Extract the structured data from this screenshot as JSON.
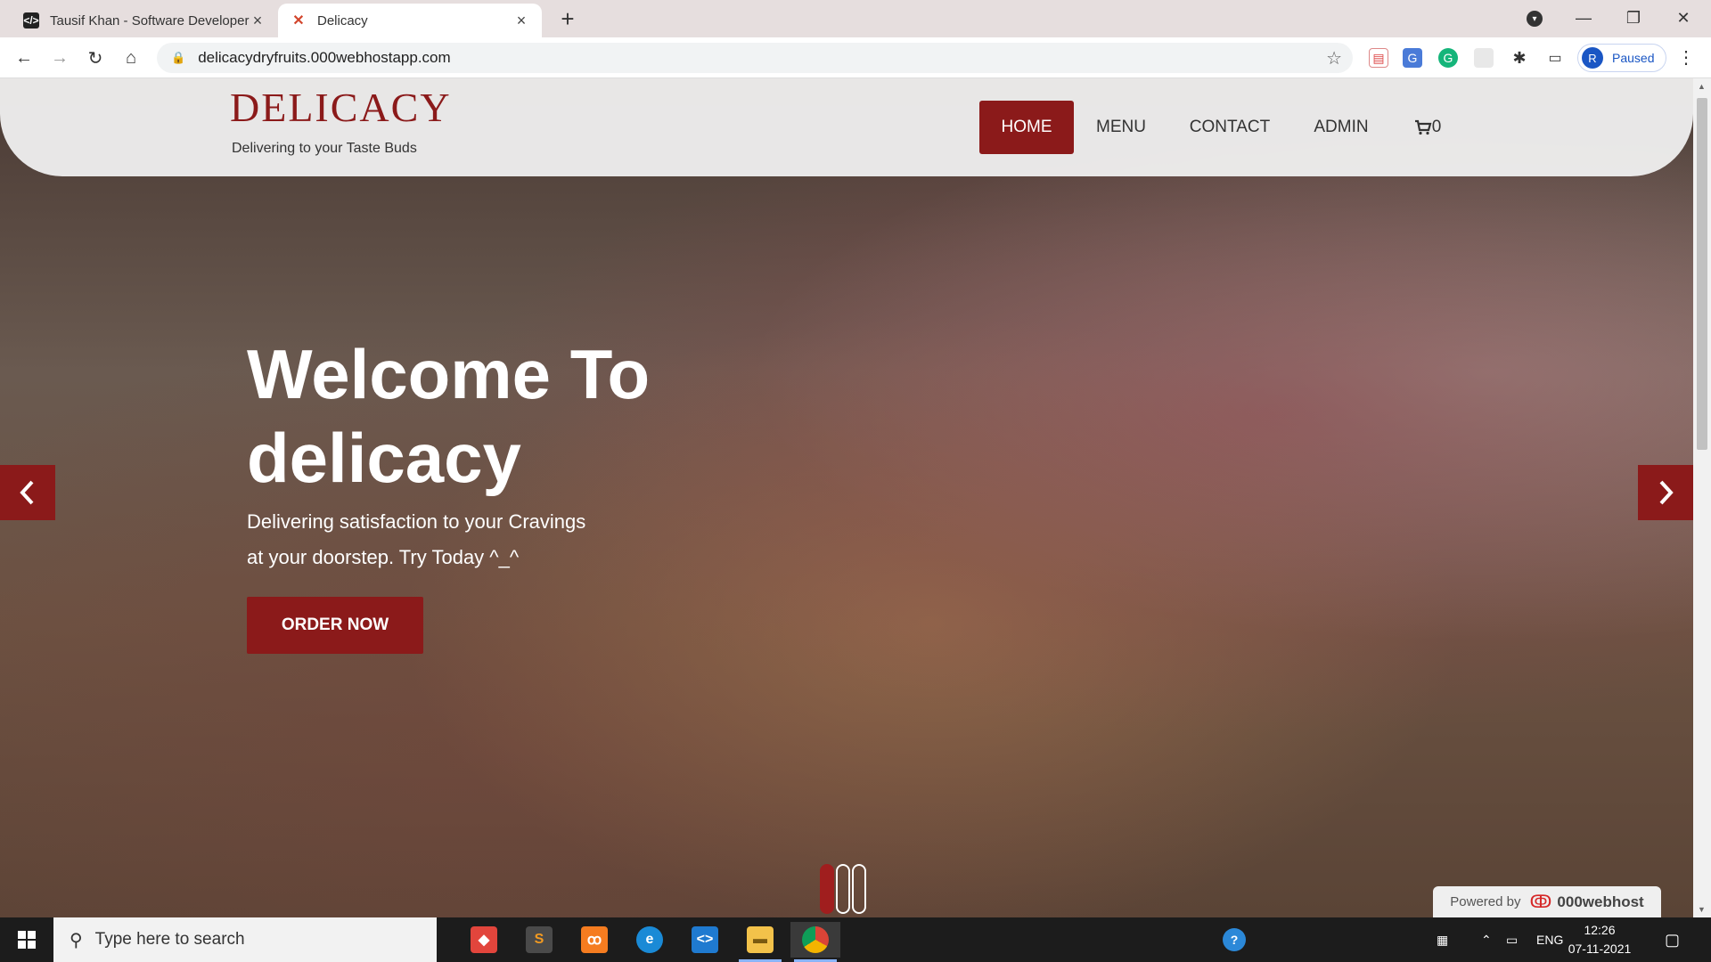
{
  "browser": {
    "tabs": [
      {
        "title": "Tausif Khan - Software Developer",
        "favicon": "code-icon"
      },
      {
        "title": "Delicacy",
        "favicon": "utensils-icon"
      }
    ],
    "url": "delicacydryfruits.000webhostapp.com",
    "profile_status": "Paused",
    "profile_initial": "R"
  },
  "site": {
    "brand": "DELICACY",
    "tagline": "Delivering to your Taste Buds",
    "nav": [
      {
        "label": "HOME",
        "active": true
      },
      {
        "label": "MENU"
      },
      {
        "label": "CONTACT"
      },
      {
        "label": "ADMIN"
      },
      {
        "label": "0",
        "icon": "cart-icon"
      }
    ],
    "hero": {
      "title_line1": "Welcome To",
      "title_line2": "delicacy",
      "subtitle_line1": "Delivering satisfaction to your Cravings",
      "subtitle_line2": "at your doorstep. Try Today ^_^",
      "cta": "ORDER NOW"
    },
    "carousel": {
      "slides": 3,
      "active_index": 0
    },
    "powered_by": {
      "prefix": "Powered by",
      "host": "000webhost"
    }
  },
  "taskbar": {
    "search_placeholder": "Type here to search",
    "language": "ENG",
    "time": "12:26",
    "date": "07-11-2021"
  },
  "colors": {
    "brand": "#8b1a1a",
    "tab_bar": "#e6dede",
    "taskbar": "#1c1c1c"
  }
}
